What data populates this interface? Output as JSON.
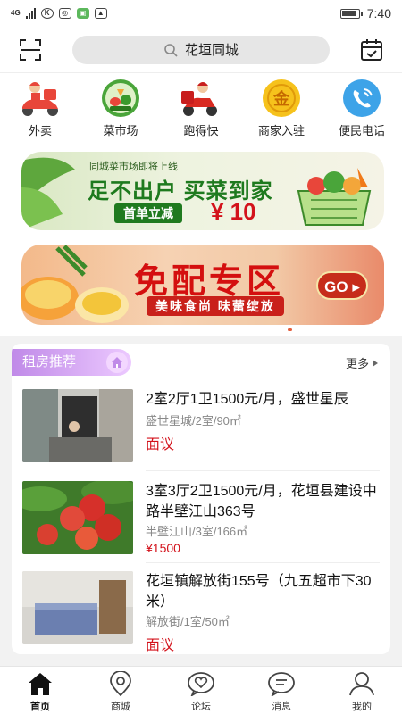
{
  "status_bar": {
    "network": "4G",
    "battery_level": 0.9,
    "time": "7:40"
  },
  "header": {
    "search_text": "花垣同城"
  },
  "categories": [
    {
      "label": "外卖",
      "icon": "delivery-rider-icon"
    },
    {
      "label": "菜市场",
      "icon": "vegetable-market-icon"
    },
    {
      "label": "跑得快",
      "icon": "errand-runner-icon"
    },
    {
      "label": "商家入驻",
      "icon": "gold-coin-icon"
    },
    {
      "label": "便民电话",
      "icon": "phone-icon"
    }
  ],
  "banner1": {
    "small_text": "同城菜市场即将上线",
    "headline": "足不出户 买菜到家",
    "tag": "首单立减",
    "price": "¥ 10"
  },
  "banner2": {
    "headline": "免配专区",
    "subline": "美味食尚 味蕾绽放",
    "go": "GO"
  },
  "rental": {
    "section_title": "租房推荐",
    "more": "更多",
    "items": [
      {
        "title": "2室2厅1卫1500元/月，盛世星辰",
        "meta": "盛世星城/2室/90㎡",
        "price": "面议"
      },
      {
        "title": "3室3厅2卫1500元/月，花垣县建设中路半壁江山363号",
        "meta": "半壁江山/3室/166㎡",
        "price": "¥1500"
      },
      {
        "title": "花垣镇解放街155号（九五超市下30米）",
        "meta": "解放街/1室/50㎡",
        "price": "面议"
      }
    ]
  },
  "tabbar": [
    {
      "label": "首页",
      "icon": "home-icon"
    },
    {
      "label": "商城",
      "icon": "location-pin-icon"
    },
    {
      "label": "论坛",
      "icon": "heart-chat-icon"
    },
    {
      "label": "消息",
      "icon": "message-icon"
    },
    {
      "label": "我的",
      "icon": "person-icon"
    }
  ],
  "colors": {
    "accent_red": "#d3121b",
    "rental_tag": "#c08ae8",
    "banner_green": "#1e7a1e"
  }
}
